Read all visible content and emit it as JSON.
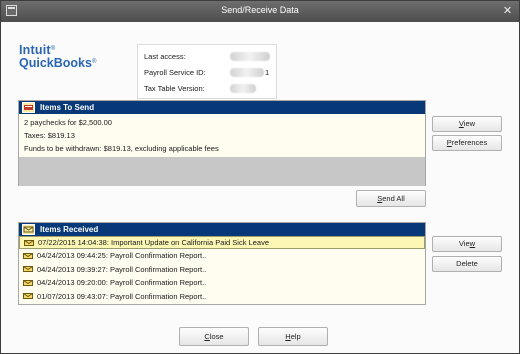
{
  "window": {
    "title": "Send/Receive Data"
  },
  "logo": {
    "line1": "Intuit",
    "line2": "QuickBooks",
    "mark": "®"
  },
  "info": {
    "last_access_label": "Last access:",
    "payroll_service_id_label": "Payroll Service ID:",
    "tax_table_version_label": "Tax Table Version:",
    "payroll_service_id_suffix": "1"
  },
  "send_panel": {
    "title": "Items To Send",
    "lines": [
      "2 paychecks for $2,500.00",
      "Taxes: $819.13",
      "Funds to be withdrawn: $819.13, excluding applicable fees"
    ]
  },
  "received_panel": {
    "title": "Items Received",
    "rows": [
      "07/22/2015 14:04:38: Important Update on California Paid Sick Leave",
      "04/24/2013 09:44:25: Payroll Confirmation Report..",
      "04/24/2013 09:39:27: Payroll Confirmation Report..",
      "04/24/2013 09:20:00: Payroll Confirmation Report..",
      "01/07/2013 09:43:07: Payroll Confirmation Report.."
    ]
  },
  "buttons": {
    "view_send": {
      "key": "V",
      "rest": "iew"
    },
    "preferences": {
      "key": "P",
      "rest": "references"
    },
    "send_all": {
      "key": "S",
      "rest": "end All"
    },
    "view_received": {
      "pre": "Vie",
      "key": "w"
    },
    "delete": "Delete",
    "close": {
      "key": "C",
      "rest": "lose"
    },
    "help": {
      "key": "H",
      "rest": "elp"
    }
  },
  "colors": {
    "panel_header": "#073877",
    "panel_body": "#fffdf0",
    "selected_row": "#fcf7b5",
    "logo": "#2a66b3",
    "title_bar": "#5a5a5a"
  },
  "icons": {
    "title_bar": "system-menu-icon",
    "send_header": "outbox-icon",
    "received_header": "inbox-icon",
    "row": "envelope-icon",
    "close": "close-icon"
  }
}
